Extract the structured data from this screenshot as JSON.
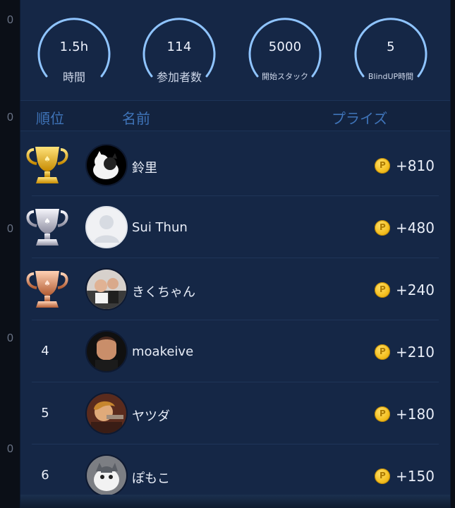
{
  "left_markers": [
    "0",
    "0",
    "0",
    "0",
    "0"
  ],
  "stats": [
    {
      "value": "1.5h",
      "label": "時間",
      "label_small": false
    },
    {
      "value": "114",
      "label": "参加者数",
      "label_small": false
    },
    {
      "value": "5000",
      "label": "開始スタック",
      "label_small": true
    },
    {
      "value": "5",
      "label": "BlindUP時間",
      "label_small": true
    }
  ],
  "header": {
    "rank": "順位",
    "name": "名前",
    "prize": "プライズ"
  },
  "rows": [
    {
      "rank": "",
      "trophy": "gold-trophy",
      "avatar": "cat-avatar",
      "name": "鈴里",
      "prize": "+810"
    },
    {
      "rank": "",
      "trophy": "silver-trophy",
      "avatar": "default-avatar",
      "name": "Sui  Thun",
      "prize": "+480"
    },
    {
      "rank": "",
      "trophy": "bronze-trophy",
      "avatar": "people-avatar",
      "name": "きくちゃん",
      "prize": "+240"
    },
    {
      "rank": "4",
      "trophy": "",
      "avatar": "man-avatar",
      "name": "moakeive",
      "prize": "+210"
    },
    {
      "rank": "5",
      "trophy": "",
      "avatar": "performer-avatar",
      "name": "ヤツダ",
      "prize": "+180"
    },
    {
      "rank": "6",
      "trophy": "",
      "avatar": "kitten-avatar",
      "name": "ぽもこ",
      "prize": "+150"
    }
  ],
  "colors": {
    "panel": "#152746",
    "header_text": "#3f74b9",
    "coin": "#f5c022",
    "gold": "#f2c21a",
    "silver": "#c9c9d3",
    "bronze": "#d28660"
  }
}
